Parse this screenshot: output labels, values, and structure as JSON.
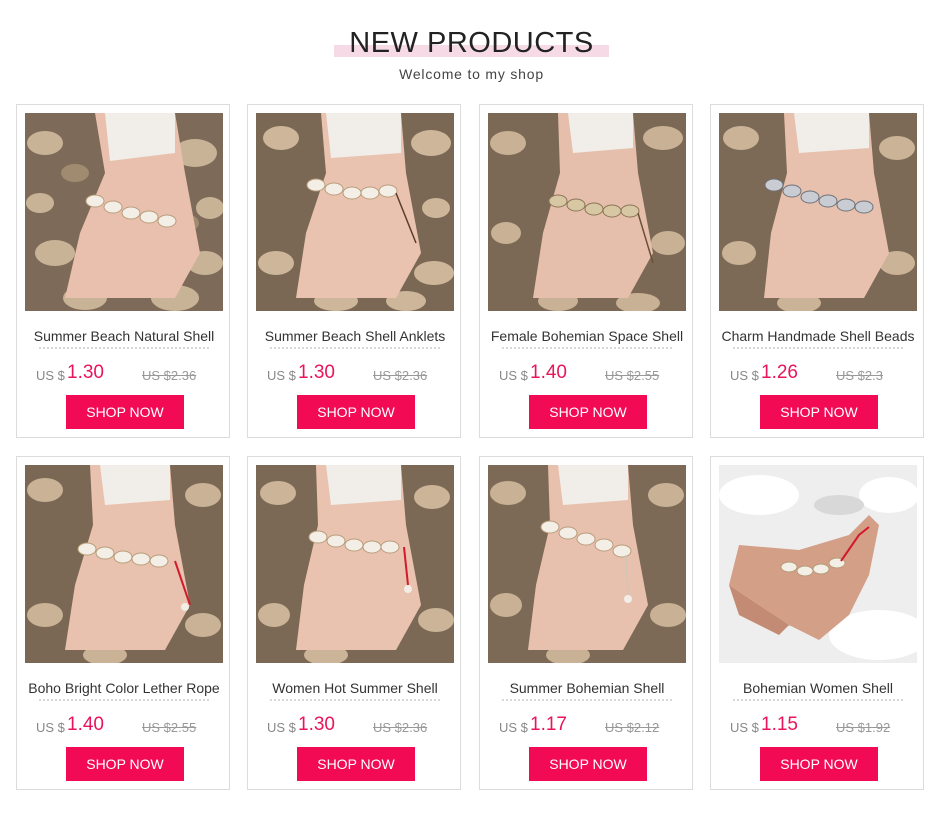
{
  "header": {
    "title": "NEW PRODUCTS",
    "subtitle": "Welcome to my shop"
  },
  "colors": {
    "accent": "#f30a55",
    "price": "#e8155a",
    "title_highlight": "#f6dbe6"
  },
  "products": [
    {
      "name": "Summer Beach Natural Shell",
      "currency": "US $",
      "price": "1.30",
      "old_price": "US $2.36",
      "button": "SHOP NOW"
    },
    {
      "name": "Summer Beach Shell Anklets",
      "currency": "US $",
      "price": "1.30",
      "old_price": "US $2.36",
      "button": "SHOP NOW"
    },
    {
      "name": "Female Bohemian Space Shell",
      "currency": "US $",
      "price": "1.40",
      "old_price": "US $2.55",
      "button": "SHOP NOW"
    },
    {
      "name": "Charm Handmade Shell Beads",
      "currency": "US $",
      "price": "1.26",
      "old_price": "US $2.3",
      "button": "SHOP NOW"
    },
    {
      "name": "Boho Bright Color Lether Rope",
      "currency": "US $",
      "price": "1.40",
      "old_price": "US $2.55",
      "button": "SHOP NOW"
    },
    {
      "name": "Women Hot Summer Shell",
      "currency": "US $",
      "price": "1.30",
      "old_price": "US $2.36",
      "button": "SHOP NOW"
    },
    {
      "name": "Summer Bohemian Shell",
      "currency": "US $",
      "price": "1.17",
      "old_price": "US $2.12",
      "button": "SHOP NOW"
    },
    {
      "name": "Bohemian Women Shell",
      "currency": "US $",
      "price": "1.15",
      "old_price": "US $1.92",
      "button": "SHOP NOW"
    }
  ]
}
